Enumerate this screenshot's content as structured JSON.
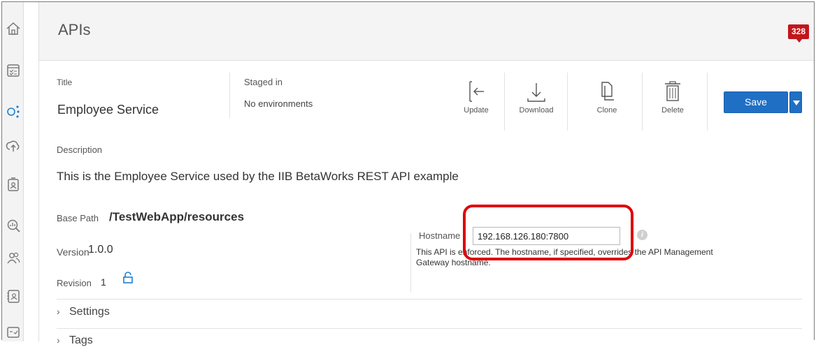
{
  "nav": {
    "items": [
      {
        "icon": "home-icon"
      },
      {
        "icon": "calendar-checklist-icon"
      },
      {
        "icon": "api-network-icon",
        "active": true
      },
      {
        "icon": "cloud-upload-icon"
      },
      {
        "icon": "id-badge-icon"
      },
      {
        "icon": "analytics-search-icon"
      },
      {
        "icon": "users-icon"
      },
      {
        "icon": "contact-card-icon"
      },
      {
        "icon": "checklist-card-icon"
      }
    ]
  },
  "header": {
    "title": "APIs",
    "notification_count": "328"
  },
  "api": {
    "title_label": "Title",
    "title_value": "Employee Service",
    "staged_label": "Staged in",
    "staged_value": "No environments",
    "description_label": "Description",
    "description_value": "This is the Employee Service used by the IIB BetaWorks REST API example",
    "base_path_label": "Base Path",
    "base_path_value": "/TestWebApp/resources",
    "version_label": "Version",
    "version_value": "1.0.0",
    "revision_label": "Revision",
    "revision_value": "1",
    "hostname_label": "Hostname",
    "hostname_value": "192.168.126.180:7800",
    "hostname_help_1": "This API is enforced. The hostname, if specified, overrides the API Management",
    "hostname_help_2": "Gateway hostname."
  },
  "actions": {
    "update": "Update",
    "download": "Download",
    "clone": "Clone",
    "delete": "Delete",
    "save": "Save"
  },
  "sections": {
    "settings": "Settings",
    "tags": "Tags"
  },
  "colors": {
    "primary_button": "#1f6fc5",
    "badge": "#c2161c",
    "highlight_box": "#e0000a"
  }
}
